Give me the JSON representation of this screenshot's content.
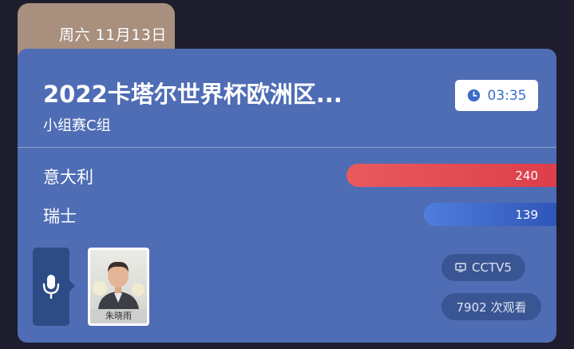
{
  "date": "周六 11月13日",
  "match": {
    "title": "2022卡塔尔世界杯欧洲区...",
    "subtitle": "小组赛C组",
    "time": "03:35"
  },
  "teams": [
    {
      "name": "意大利",
      "votes": "240",
      "bar_color": "#dc3f4a"
    },
    {
      "name": "瑞士",
      "votes": "139",
      "bar_color": "#2f55b8"
    }
  ],
  "commentator": {
    "name": "朱晓雨"
  },
  "channel": "CCTV5",
  "views": "7902 次观看",
  "icons": {
    "time": "clock-icon",
    "mic": "microphone-icon",
    "channel": "tv-icon"
  },
  "colors": {
    "background": "#1e1d2e",
    "card": "#4f6db5",
    "date_tab": "#a88f7e",
    "accent_blue": "#3a6cc8"
  }
}
